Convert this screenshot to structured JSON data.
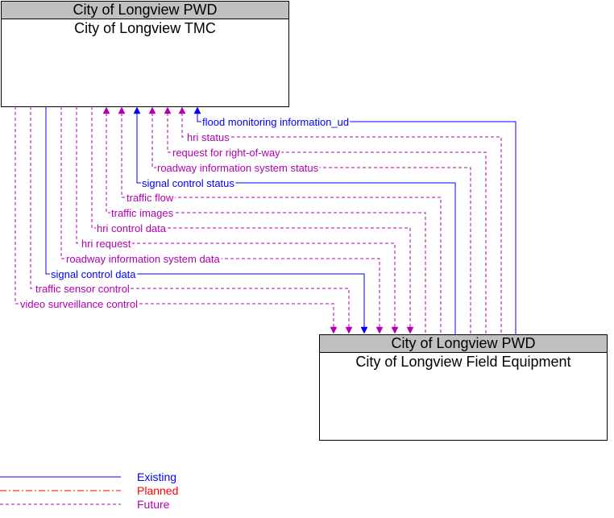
{
  "colors": {
    "existing": "#0000ff",
    "planned": "#ff0000",
    "future": "#b000b0",
    "header_bg": "#c0c0c0"
  },
  "nodes": {
    "tmc": {
      "agency": "City of Longview PWD",
      "name": "City of Longview TMC"
    },
    "field": {
      "agency": "City of Longview PWD",
      "name": "City of Longview Field Equipment"
    }
  },
  "flows": [
    {
      "label": "flood monitoring information_ud",
      "status": "existing",
      "direction": "to-tmc"
    },
    {
      "label": "hri status",
      "status": "future",
      "direction": "to-tmc"
    },
    {
      "label": "request for right-of-way",
      "status": "future",
      "direction": "to-tmc"
    },
    {
      "label": "roadway information system status",
      "status": "future",
      "direction": "to-tmc"
    },
    {
      "label": "signal control status",
      "status": "existing",
      "direction": "to-tmc"
    },
    {
      "label": "traffic flow",
      "status": "future",
      "direction": "to-tmc"
    },
    {
      "label": "traffic images",
      "status": "future",
      "direction": "to-tmc"
    },
    {
      "label": "hri control data",
      "status": "future",
      "direction": "to-field"
    },
    {
      "label": "hri request",
      "status": "future",
      "direction": "to-field"
    },
    {
      "label": "roadway information system data",
      "status": "future",
      "direction": "to-field"
    },
    {
      "label": "signal control data",
      "status": "existing",
      "direction": "to-field"
    },
    {
      "label": "traffic sensor control",
      "status": "future",
      "direction": "to-field"
    },
    {
      "label": "video surveillance control",
      "status": "future",
      "direction": "to-field"
    }
  ],
  "legend": [
    {
      "label": "Existing",
      "status": "existing"
    },
    {
      "label": "Planned",
      "status": "planned"
    },
    {
      "label": "Future",
      "status": "future"
    }
  ]
}
